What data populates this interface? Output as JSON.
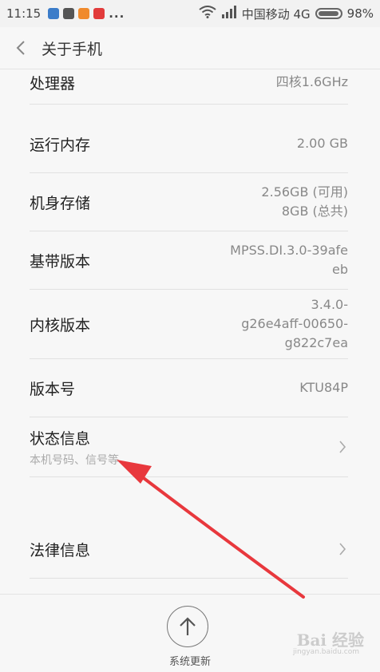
{
  "status_bar": {
    "time": "11:15",
    "dots": "...",
    "carrier": "中国移动 4G",
    "battery": "98%",
    "app_icon_colors": [
      "#3b7cc9",
      "#555555",
      "#f08a2c",
      "#e23b3b"
    ]
  },
  "header": {
    "title": "关于手机"
  },
  "rows": [
    {
      "label": "处理器",
      "value": "四核1.6GHz"
    },
    {
      "label": "运行内存",
      "value": "2.00 GB"
    },
    {
      "label": "机身存储",
      "value": "2.56GB (可用)\n8GB (总共)"
    },
    {
      "label": "基带版本",
      "value": "MPSS.DI.3.0-39afe\neb"
    },
    {
      "label": "内核版本",
      "value": "3.4.0-\ng26e4aff-00650-\ng822c7ea"
    },
    {
      "label": "版本号",
      "value": "KTU84P"
    },
    {
      "label": "状态信息",
      "sub": "本机号码、信号等"
    },
    {
      "label": "法律信息"
    }
  ],
  "bottom": {
    "update_label": "系统更新"
  },
  "watermark": {
    "text": "Bai 经验",
    "sub": "jingyan.baidu.com"
  },
  "colors": {
    "annotation_arrow": "#e8383d"
  }
}
